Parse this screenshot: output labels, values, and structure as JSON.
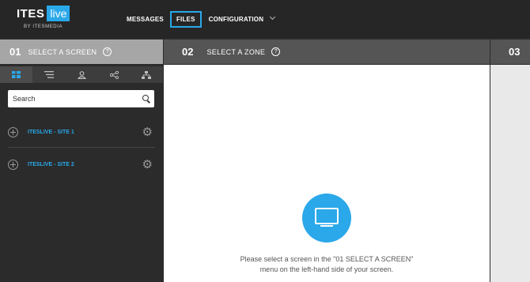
{
  "brand": {
    "name": "ITES",
    "badge": "live",
    "byline": "BY ITESMEDIA",
    "accent": "#2aa8e9"
  },
  "nav": {
    "items": [
      {
        "label": "MESSAGES"
      },
      {
        "label": "FILES",
        "active": true
      },
      {
        "label": "CONFIGURATION"
      }
    ]
  },
  "col1": {
    "number": "01",
    "title": "SELECT A SCREEN",
    "help": "?",
    "tabs": [
      {
        "icon": "grid-icon",
        "active": true
      },
      {
        "icon": "list-filter-icon"
      },
      {
        "icon": "user-icon"
      },
      {
        "icon": "share-icon"
      },
      {
        "icon": "hierarchy-icon"
      }
    ],
    "search": {
      "placeholder": "Search",
      "value": ""
    },
    "sites": [
      {
        "label": "ITESLIVE - SITE 1"
      },
      {
        "label": "ITESLIVE - SITE 2"
      }
    ]
  },
  "col2": {
    "number": "02",
    "title": "SELECT A ZONE",
    "help": "?",
    "hint_line1": "Please select a screen in the \"01 SELECT A SCREEN\"",
    "hint_line2": "menu on the left-hand side of your screen."
  },
  "col3": {
    "number": "03"
  }
}
